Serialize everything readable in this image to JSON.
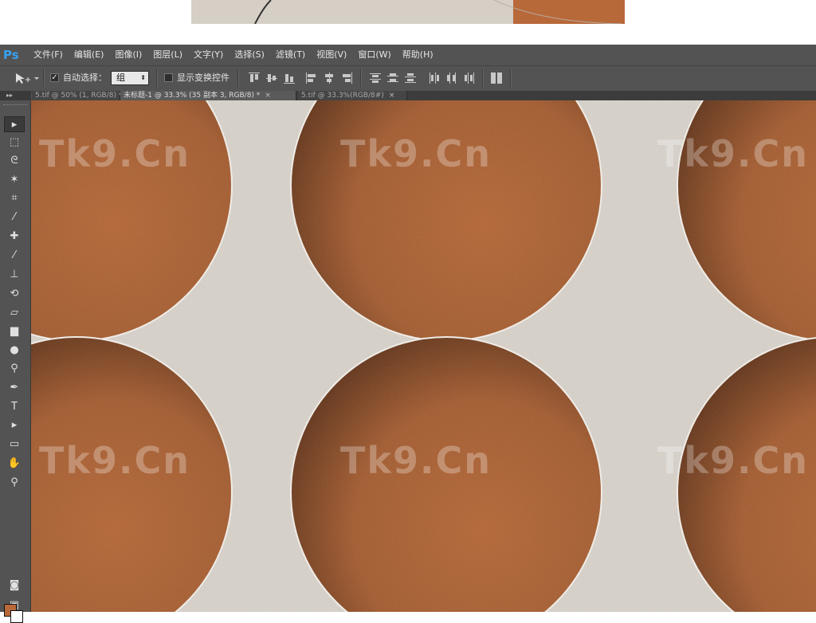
{
  "app": {
    "logo": "Ps"
  },
  "menu": {
    "items": [
      "文件(F)",
      "编辑(E)",
      "图像(I)",
      "图层(L)",
      "文字(Y)",
      "选择(S)",
      "滤镜(T)",
      "视图(V)",
      "窗口(W)",
      "帮助(H)"
    ]
  },
  "options": {
    "auto_select_label": "自动选择：",
    "auto_select_checked": "✓",
    "auto_select_value": "组",
    "show_transform_label": "显示变换控件"
  },
  "tabs": [
    {
      "label": "5.tif @ 50% (1, RGB/8) *",
      "close": "×"
    },
    {
      "label": "未标题-1 @ 33.3% (35 副本 3, RGB/8) *",
      "close": "×"
    },
    {
      "label": "5.tif @ 33.3%(RGB/8#)",
      "close": "×"
    }
  ],
  "toolbox": {
    "collapse": "▸▸",
    "tools": [
      {
        "name": "move-tool-icon",
        "glyph": "▸"
      },
      {
        "name": "marquee-tool-icon",
        "glyph": "⬚"
      },
      {
        "name": "lasso-tool-icon",
        "glyph": "ᘓ"
      },
      {
        "name": "magic-wand-tool-icon",
        "glyph": "✶"
      },
      {
        "name": "crop-tool-icon",
        "glyph": "⌗"
      },
      {
        "name": "eyedropper-tool-icon",
        "glyph": "⁄"
      },
      {
        "name": "healing-brush-tool-icon",
        "glyph": "✚"
      },
      {
        "name": "brush-tool-icon",
        "glyph": "⁄"
      },
      {
        "name": "clone-stamp-tool-icon",
        "glyph": "⊥"
      },
      {
        "name": "history-brush-tool-icon",
        "glyph": "⟲"
      },
      {
        "name": "eraser-tool-icon",
        "glyph": "▱"
      },
      {
        "name": "gradient-tool-icon",
        "glyph": "▆"
      },
      {
        "name": "blur-tool-icon",
        "glyph": "●"
      },
      {
        "name": "dodge-tool-icon",
        "glyph": "⚲"
      },
      {
        "name": "pen-tool-icon",
        "glyph": "✒"
      },
      {
        "name": "type-tool-icon",
        "glyph": "T"
      },
      {
        "name": "path-selection-tool-icon",
        "glyph": "▸"
      },
      {
        "name": "rectangle-tool-icon",
        "glyph": "▭"
      },
      {
        "name": "hand-tool-icon",
        "glyph": "✋"
      },
      {
        "name": "zoom-tool-icon",
        "glyph": "⚲"
      }
    ],
    "quick_mask_glyph": "◙",
    "screen_mode_glyph": "▣"
  },
  "canvas": {
    "watermark": "Tk9.Cn",
    "paper_color": "#d8d2ca",
    "clay_color": "#a85a2e"
  },
  "colors": {
    "foreground": "#b8693a",
    "background": "#ffffff",
    "ui_panel": "#535353",
    "logo": "#38a0f0"
  }
}
